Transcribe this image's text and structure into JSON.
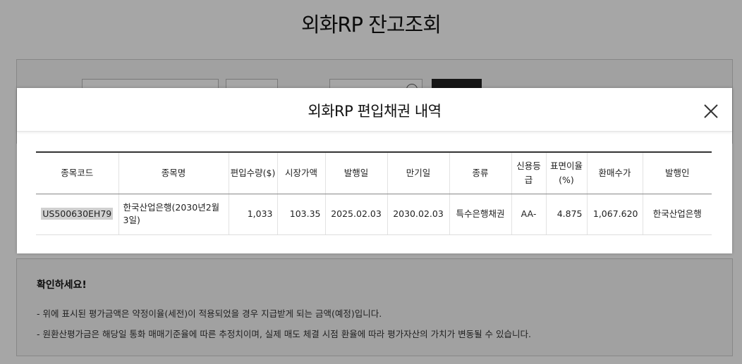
{
  "page": {
    "title": "외화RP 잔고조회"
  },
  "search": {
    "select1_value": "",
    "select2_value": "",
    "search_button": ""
  },
  "notice": {
    "title": "확인하세요!",
    "lines": [
      "- 위에 표시된 평가금액은 약정이율(세전)이 적용되었을 경우 지급받게 되는 금액(예정)입니다.",
      "- 원환산평가금은 해당일 통화 매매기준율에 따른 추정치이며, 실제 매도 체결 시점 환율에 따라 평가자산의 가치가 변동될 수 있습니다."
    ]
  },
  "modal": {
    "title": "외화RP 편입채권 내역",
    "close_icon": "close-icon",
    "columns": {
      "code": "종목코드",
      "name": "종목명",
      "qty": "편입수량($)",
      "market_price": "시장가액",
      "issue_date": "발행일",
      "maturity_date": "만기일",
      "type": "종류",
      "credit_grade": "신용등급",
      "coupon_rate": "표면이율(%)",
      "repurchase_price": "환매수가",
      "issuer": "발행인"
    },
    "rows": [
      {
        "code": "US500630EH79",
        "name": "한국산업은행(2030년2월3일)",
        "qty": "1,033",
        "market_price": "103.35",
        "issue_date": "2025.02.03",
        "maturity_date": "2030.02.03",
        "type": "특수은행채권",
        "credit_grade": "AA-",
        "coupon_rate": "4.875",
        "repurchase_price": "1,067.620",
        "issuer": "한국산업은행"
      }
    ]
  },
  "colors": {
    "overlay": "#000000",
    "header_border": "#333333",
    "highlight": "#d0d0d0"
  }
}
